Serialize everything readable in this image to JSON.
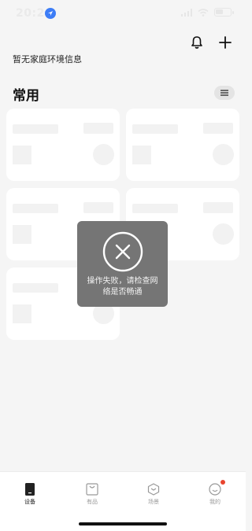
{
  "status_bar": {
    "time": "20:24"
  },
  "header": {
    "home_info": "暂无家庭环境信息",
    "bell_icon": "bell-icon",
    "add_icon": "plus-icon"
  },
  "section": {
    "title": "常用",
    "menu_icon": "list-menu-icon"
  },
  "placeholder_cards": 5,
  "toast": {
    "icon": "close-circle-icon",
    "message_line1": "操作失败，请检查网",
    "message_line2": "络是否畅通"
  },
  "tabs": [
    {
      "label": "设备",
      "icon": "device-icon",
      "active": true
    },
    {
      "label": "有品",
      "icon": "shopping-bag-icon",
      "active": false
    },
    {
      "label": "场景",
      "icon": "scene-icon",
      "active": false
    },
    {
      "label": "我的",
      "icon": "profile-icon",
      "active": false,
      "badge": true
    }
  ],
  "colors": {
    "background": "#f5f5f5",
    "toast_bg": "#6e6e6e",
    "accent_blue": "#3d7df6",
    "badge_red": "#e8442e"
  }
}
